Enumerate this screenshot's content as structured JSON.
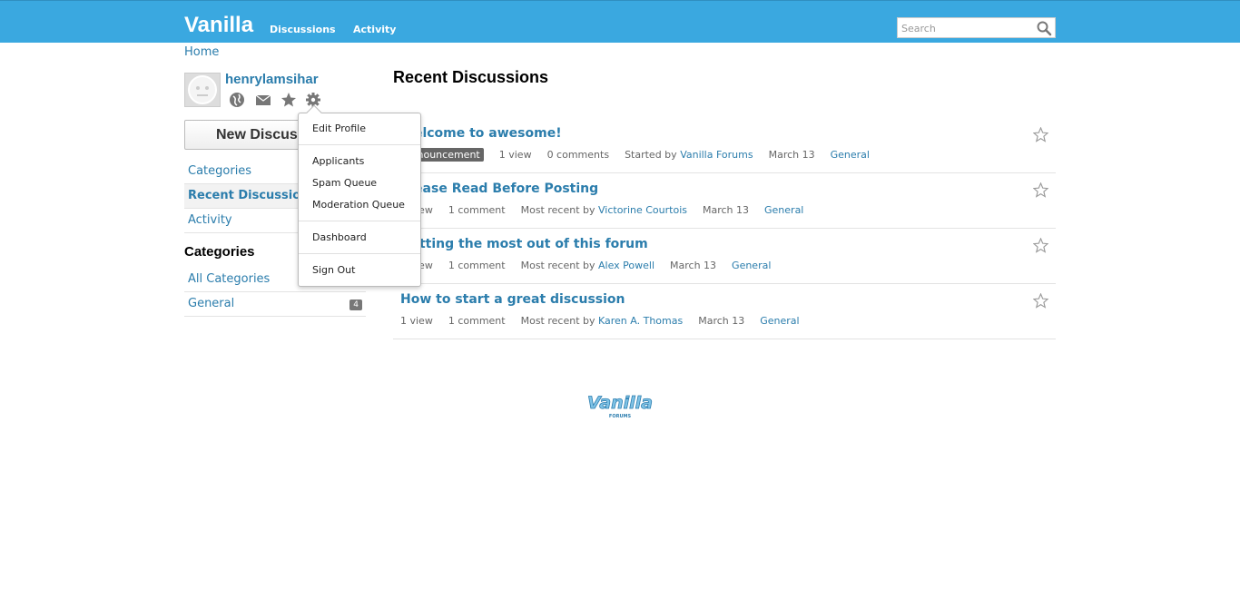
{
  "header": {
    "brand": "Vanilla",
    "nav": [
      "Discussions",
      "Activity"
    ],
    "search_placeholder": "Search"
  },
  "breadcrumb": "Home",
  "user": {
    "name": "henrylamsihar"
  },
  "new_discussion_label": "New Discussion",
  "sidebar": {
    "nav": [
      {
        "label": "Categories",
        "active": false
      },
      {
        "label": "Recent Discussions",
        "active": true
      },
      {
        "label": "Activity",
        "active": false
      }
    ],
    "categories_heading": "Categories",
    "categories": [
      {
        "label": "All Categories",
        "count": ""
      },
      {
        "label": "General",
        "count": "4"
      }
    ]
  },
  "main": {
    "title": "Recent Discussions",
    "discussions": [
      {
        "title": "Welcome to awesome!",
        "tag": "Announcement",
        "views": "1 view",
        "comments": "0 comments",
        "by_label": "Started by",
        "author": "Vanilla Forums",
        "date": "March 13",
        "category": "General"
      },
      {
        "title": "Please Read Before Posting",
        "tag": "",
        "views": "1 view",
        "comments": "1 comment",
        "by_label": "Most recent by",
        "author": "Victorine Courtois",
        "date": "March 13",
        "category": "General"
      },
      {
        "title": "Getting the most out of this forum",
        "tag": "",
        "views": "1 view",
        "comments": "1 comment",
        "by_label": "Most recent by",
        "author": "Alex Powell",
        "date": "March 13",
        "category": "General"
      },
      {
        "title": "How to start a great discussion",
        "tag": "",
        "views": "1 view",
        "comments": "1 comment",
        "by_label": "Most recent by",
        "author": "Karen A. Thomas",
        "date": "March 13",
        "category": "General"
      }
    ]
  },
  "dropdown": {
    "items": [
      "Edit Profile",
      "Applicants",
      "Spam Queue",
      "Moderation Queue",
      "Dashboard",
      "Sign Out"
    ]
  },
  "footer": {
    "logo_text": "Vanilla",
    "logo_sub": "FORUMS"
  },
  "colors": {
    "header": "#3aa8e0",
    "link": "#2b7dac"
  }
}
